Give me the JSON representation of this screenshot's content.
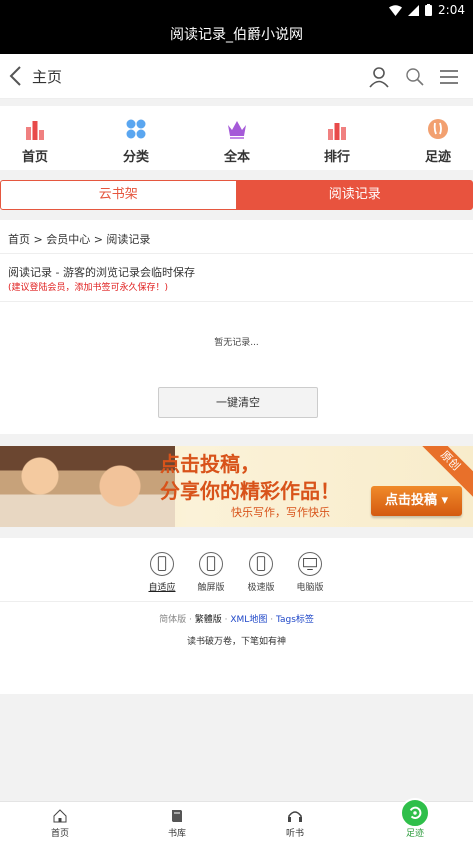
{
  "status_bar": {
    "time": "2:04"
  },
  "window": {
    "title": "阅读记录_伯爵小说网"
  },
  "header": {
    "back_label": "主页"
  },
  "nav": [
    {
      "label": "首页",
      "icon": "bar-chart-icon",
      "color": "#f05a5a"
    },
    {
      "label": "分类",
      "icon": "grid-dots-icon",
      "color": "#4a9df0"
    },
    {
      "label": "全本",
      "icon": "crown-icon",
      "color": "#a55ad8"
    },
    {
      "label": "排行",
      "icon": "ranking-icon",
      "color": "#f05a5a"
    },
    {
      "label": "足迹",
      "icon": "footprint-icon",
      "color": "#f08a4a"
    }
  ],
  "tabs": {
    "shelf": "云书架",
    "record": "阅读记录"
  },
  "content": {
    "breadcrumb": "首页 > 会员中心 > 阅读记录",
    "description": "阅读记录 - 游客的浏览记录会临时保存",
    "tip": "(建议登陆会员，添加书签可永久保存！)",
    "empty": "暂无记录...",
    "clear_button": "一键清空"
  },
  "banner": {
    "line1": "点击投稿，",
    "line2": "分享你的精彩作品！",
    "line3": "快乐写作，写作快乐",
    "cta": "点击投稿 ▾",
    "corner": "原创"
  },
  "footer": {
    "versions": [
      {
        "label": "自适应",
        "active": true
      },
      {
        "label": "触屏版",
        "active": false
      },
      {
        "label": "极速版",
        "active": false
      },
      {
        "label": "电脑版",
        "active": false
      }
    ],
    "links": {
      "simplified": "简体版",
      "traditional": "繁體版",
      "xml_map": "XML地图",
      "tags": "Tags标签",
      "dot": "·"
    },
    "motto": "读书破万卷，下笔如有神"
  },
  "bottom_bar": [
    {
      "label": "首页",
      "icon": "home-icon"
    },
    {
      "label": "书库",
      "icon": "book-icon"
    },
    {
      "label": "听书",
      "icon": "headphones-icon"
    },
    {
      "label": "足迹",
      "icon": "footprint-icon",
      "active": true
    }
  ],
  "colors": {
    "accent": "#e8533e",
    "active_green": "#2fbf4a",
    "link_blue": "#2048c8"
  }
}
